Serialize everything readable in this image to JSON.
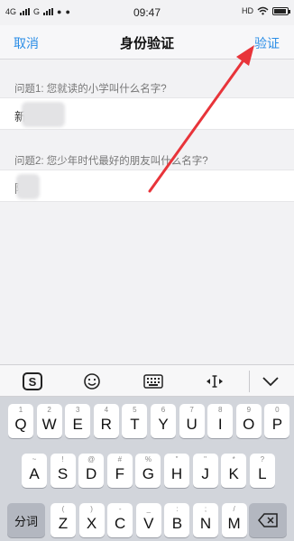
{
  "status_bar": {
    "network_left": "4G",
    "network_left2": "G",
    "time": "09:47",
    "hd_label": "HD"
  },
  "nav": {
    "cancel_label": "取消",
    "title": "身份验证",
    "verify_label": "验证"
  },
  "questions": [
    {
      "label": "问题1: 您就读的小学叫什么名字?",
      "answer_visible": "新"
    },
    {
      "label": "问题2: 您少年时代最好的朋友叫什么名字?",
      "answer_visible": "陈"
    }
  ],
  "annotation": {
    "arrow_color": "#e8343a",
    "arrow_target": "verify-button"
  },
  "keyboard": {
    "toolbar_icons": [
      "sogou-logo-icon",
      "emoji-icon",
      "keyboard-icon",
      "cursor-move-icon",
      "collapse-keyboard-icon"
    ],
    "row1": [
      {
        "k": "Q",
        "h": "1"
      },
      {
        "k": "W",
        "h": "2"
      },
      {
        "k": "E",
        "h": "3"
      },
      {
        "k": "R",
        "h": "4"
      },
      {
        "k": "T",
        "h": "5"
      },
      {
        "k": "Y",
        "h": "6"
      },
      {
        "k": "U",
        "h": "7"
      },
      {
        "k": "I",
        "h": "8"
      },
      {
        "k": "O",
        "h": "9"
      },
      {
        "k": "P",
        "h": "0"
      }
    ],
    "row2": [
      {
        "k": "A",
        "h": "~"
      },
      {
        "k": "S",
        "h": "!"
      },
      {
        "k": "D",
        "h": "@"
      },
      {
        "k": "F",
        "h": "#"
      },
      {
        "k": "G",
        "h": "%"
      },
      {
        "k": "H",
        "h": "\""
      },
      {
        "k": "J",
        "h": "\""
      },
      {
        "k": "K",
        "h": "*"
      },
      {
        "k": "L",
        "h": "?"
      }
    ],
    "row3": [
      {
        "k": "Z",
        "h": "("
      },
      {
        "k": "X",
        "h": ")"
      },
      {
        "k": "C",
        "h": "-"
      },
      {
        "k": "V",
        "h": "_"
      },
      {
        "k": "B",
        "h": ":"
      },
      {
        "k": "N",
        "h": ";"
      },
      {
        "k": "M",
        "h": "/"
      }
    ],
    "fenci_label": "分词"
  }
}
